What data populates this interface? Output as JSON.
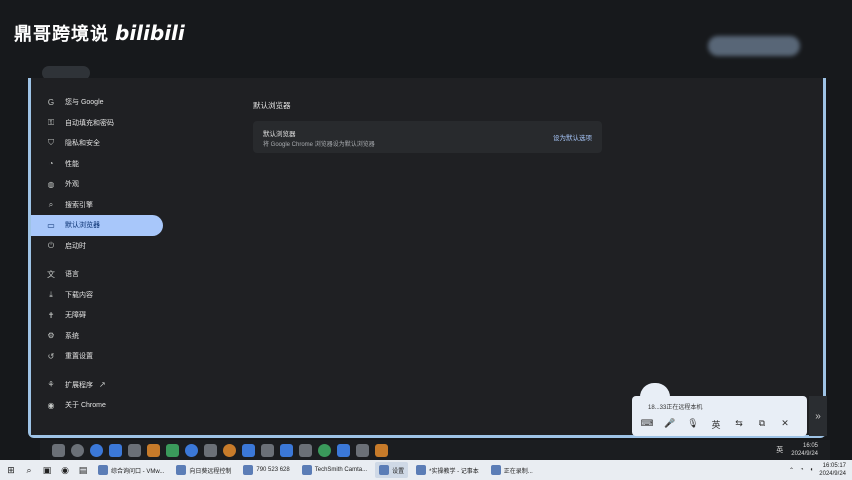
{
  "watermark": {
    "name": "鼎哥跨境说",
    "logo": "bilibili"
  },
  "sidebar": {
    "items": [
      {
        "label": "您与 Google",
        "icon": "G"
      },
      {
        "label": "自动填充和密码",
        "icon": "⚿"
      },
      {
        "label": "隐私和安全",
        "icon": "⛉"
      },
      {
        "label": "性能",
        "icon": "◔"
      },
      {
        "label": "外观",
        "icon": "◍"
      },
      {
        "label": "搜索引擎",
        "icon": "⌕"
      },
      {
        "label": "默认浏览器",
        "icon": "▭"
      },
      {
        "label": "启动时",
        "icon": "⏻"
      },
      {
        "label": "语言",
        "icon": "文"
      },
      {
        "label": "下载内容",
        "icon": "⤓"
      },
      {
        "label": "无障碍",
        "icon": "✝"
      },
      {
        "label": "系统",
        "icon": "⚙"
      },
      {
        "label": "重置设置",
        "icon": "↺"
      },
      {
        "label": "扩展程序",
        "icon": "⚘"
      },
      {
        "label": "关于 Chrome",
        "icon": "◉"
      }
    ],
    "ext_link_icon": "↗"
  },
  "main": {
    "section_title": "默认浏览器",
    "card_title": "默认浏览器",
    "card_desc": "将 Google Chrome 浏览器设为默认浏览器",
    "set_default_label": "设为默认选项"
  },
  "ime": {
    "status": "18...33正在远程本机",
    "tools": [
      "⌨",
      "🎤",
      "🎙",
      "英",
      "⇆",
      "⧉",
      "✕"
    ],
    "expand": "»"
  },
  "dock": {
    "tray_lang": "英",
    "time": "16:05",
    "date": "2024/9/24"
  },
  "taskbar": {
    "start_icon": "⊞",
    "items": [
      {
        "label": "综合询问口 - VMw..."
      },
      {
        "label": "向日葵远程控制"
      },
      {
        "label": "790 523 628"
      },
      {
        "label": "TechSmith Camta..."
      },
      {
        "label": "设置"
      },
      {
        "label": "*实操教学 - 记事本"
      },
      {
        "label": "正在录制..."
      }
    ],
    "active_index": 4,
    "time": "16:05:17",
    "date": "2024/9/24"
  }
}
